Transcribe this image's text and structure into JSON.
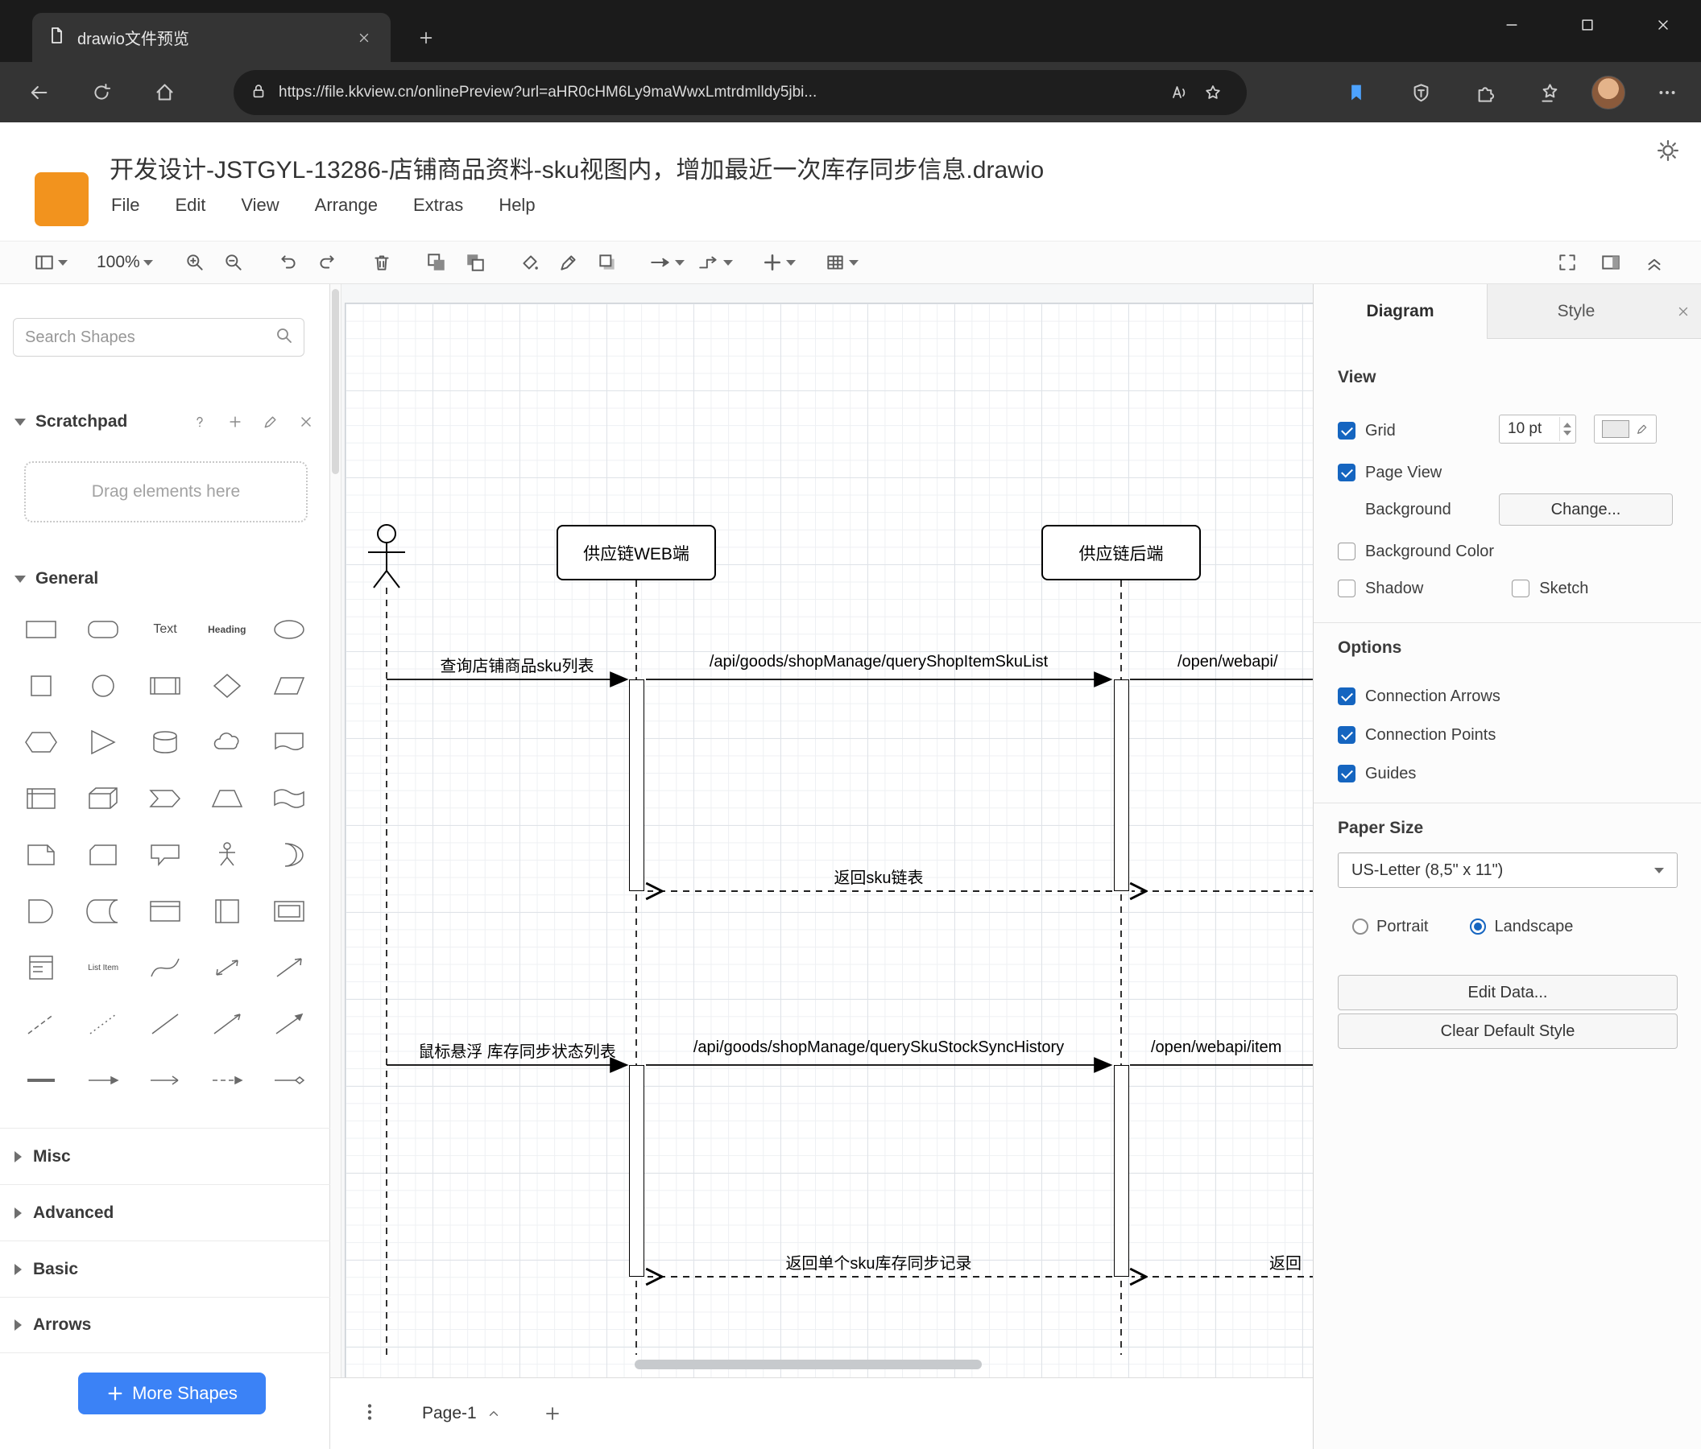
{
  "colors": {
    "accent": "#1565c0",
    "primary_button": "#3b82f6",
    "logo": "#f2931e"
  },
  "browser": {
    "tab_title": "drawio文件预览",
    "url": "https://file.kkview.cn/onlinePreview?url=aHR0cHM6Ly9maWwxLmtrdmlldy5jbi..."
  },
  "app": {
    "title": "开发设计-JSTGYL-13286-店铺商品资料-sku视图内，增加最近一次库存同步信息.drawio",
    "menus": [
      "File",
      "Edit",
      "View",
      "Arrange",
      "Extras",
      "Help"
    ],
    "zoom": "100%"
  },
  "sidebar": {
    "search_placeholder": "Search Shapes",
    "scratchpad_title": "Scratchpad",
    "scratchpad_hint": "Drag elements here",
    "sections": {
      "general": "General",
      "misc": "Misc",
      "advanced": "Advanced",
      "basic": "Basic",
      "arrows": "Arrows"
    },
    "shape_labels": {
      "text": "Text",
      "heading": "Heading",
      "list_item": "List Item"
    },
    "more_shapes": "More Shapes"
  },
  "canvas": {
    "participants": {
      "web": "供应链WEB端",
      "backend": "供应链后端"
    },
    "messages": {
      "query_sku_list": "查询店铺商品sku列表",
      "api_query_shop_item_sku_list": "/api/goods/shopManage/queryShopItemSkuList",
      "open_webapi": "/open/webapi/",
      "return_sku_list": "返回sku链表",
      "hover_stock_sync": "鼠标悬浮 库存同步状态列表",
      "api_query_sku_stock_sync_history": "/api/goods/shopManage/querySkuStockSyncHistory",
      "open_webapi_item": "/open/webapi/item",
      "return_single_sku": "返回单个sku库存同步记录",
      "return_partial": "返回"
    },
    "page_tab": "Page-1"
  },
  "panel": {
    "tabs": {
      "diagram": "Diagram",
      "style": "Style"
    },
    "view": {
      "heading": "View",
      "grid": "Grid",
      "grid_size": "10 pt",
      "page_view": "Page View",
      "background": "Background",
      "change": "Change...",
      "background_color": "Background Color",
      "shadow": "Shadow",
      "sketch": "Sketch"
    },
    "options": {
      "heading": "Options",
      "connection_arrows": "Connection Arrows",
      "connection_points": "Connection Points",
      "guides": "Guides"
    },
    "paper": {
      "heading": "Paper Size",
      "size": "US-Letter (8,5\" x 11\")",
      "portrait": "Portrait",
      "landscape": "Landscape"
    },
    "edit_data": "Edit Data...",
    "clear_default_style": "Clear Default Style"
  }
}
